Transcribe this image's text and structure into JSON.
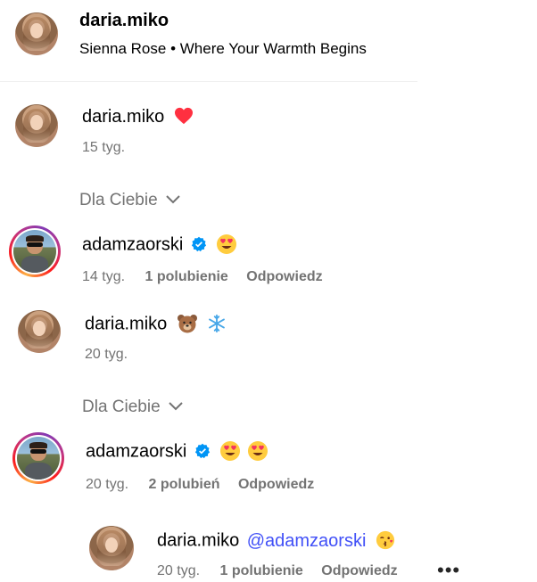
{
  "post_header": {
    "username": "daria.miko",
    "subtitle": "Sienna Rose • Where Your Warmth Begins"
  },
  "comments": [
    {
      "username": "daria.miko",
      "emoji_icons": [
        "red-heart-emoji"
      ],
      "time": "15 tyg."
    },
    {
      "section_label": "Dla Ciebie",
      "username": "adamzaorski",
      "verified": true,
      "emoji_icons": [
        "heart-eyes-emoji"
      ],
      "time": "14 tyg.",
      "likes": "1 polubienie",
      "reply": "Odpowiedz"
    },
    {
      "username": "daria.miko",
      "emoji_icons": [
        "bear-emoji",
        "snowflake-emoji"
      ],
      "time": "20 tyg."
    },
    {
      "section_label": "Dla Ciebie",
      "username": "adamzaorski",
      "verified": true,
      "emoji_icons": [
        "heart-eyes-emoji",
        "heart-eyes-emoji"
      ],
      "time": "20 tyg.",
      "likes": "2 polubień",
      "reply": "Odpowiedz"
    },
    {
      "username": "daria.miko",
      "mention": "@adamzaorski",
      "emoji_icons": [
        "kissing-emoji"
      ],
      "time": "20 tyg.",
      "likes": "1 polubienie",
      "reply": "Odpowiedz"
    }
  ],
  "more_options": "•••",
  "colors": {
    "meta_gray": "#737373",
    "mention_blue": "#4150f7",
    "verified_blue": "#0095f6",
    "heart_red": "#ff3040"
  }
}
